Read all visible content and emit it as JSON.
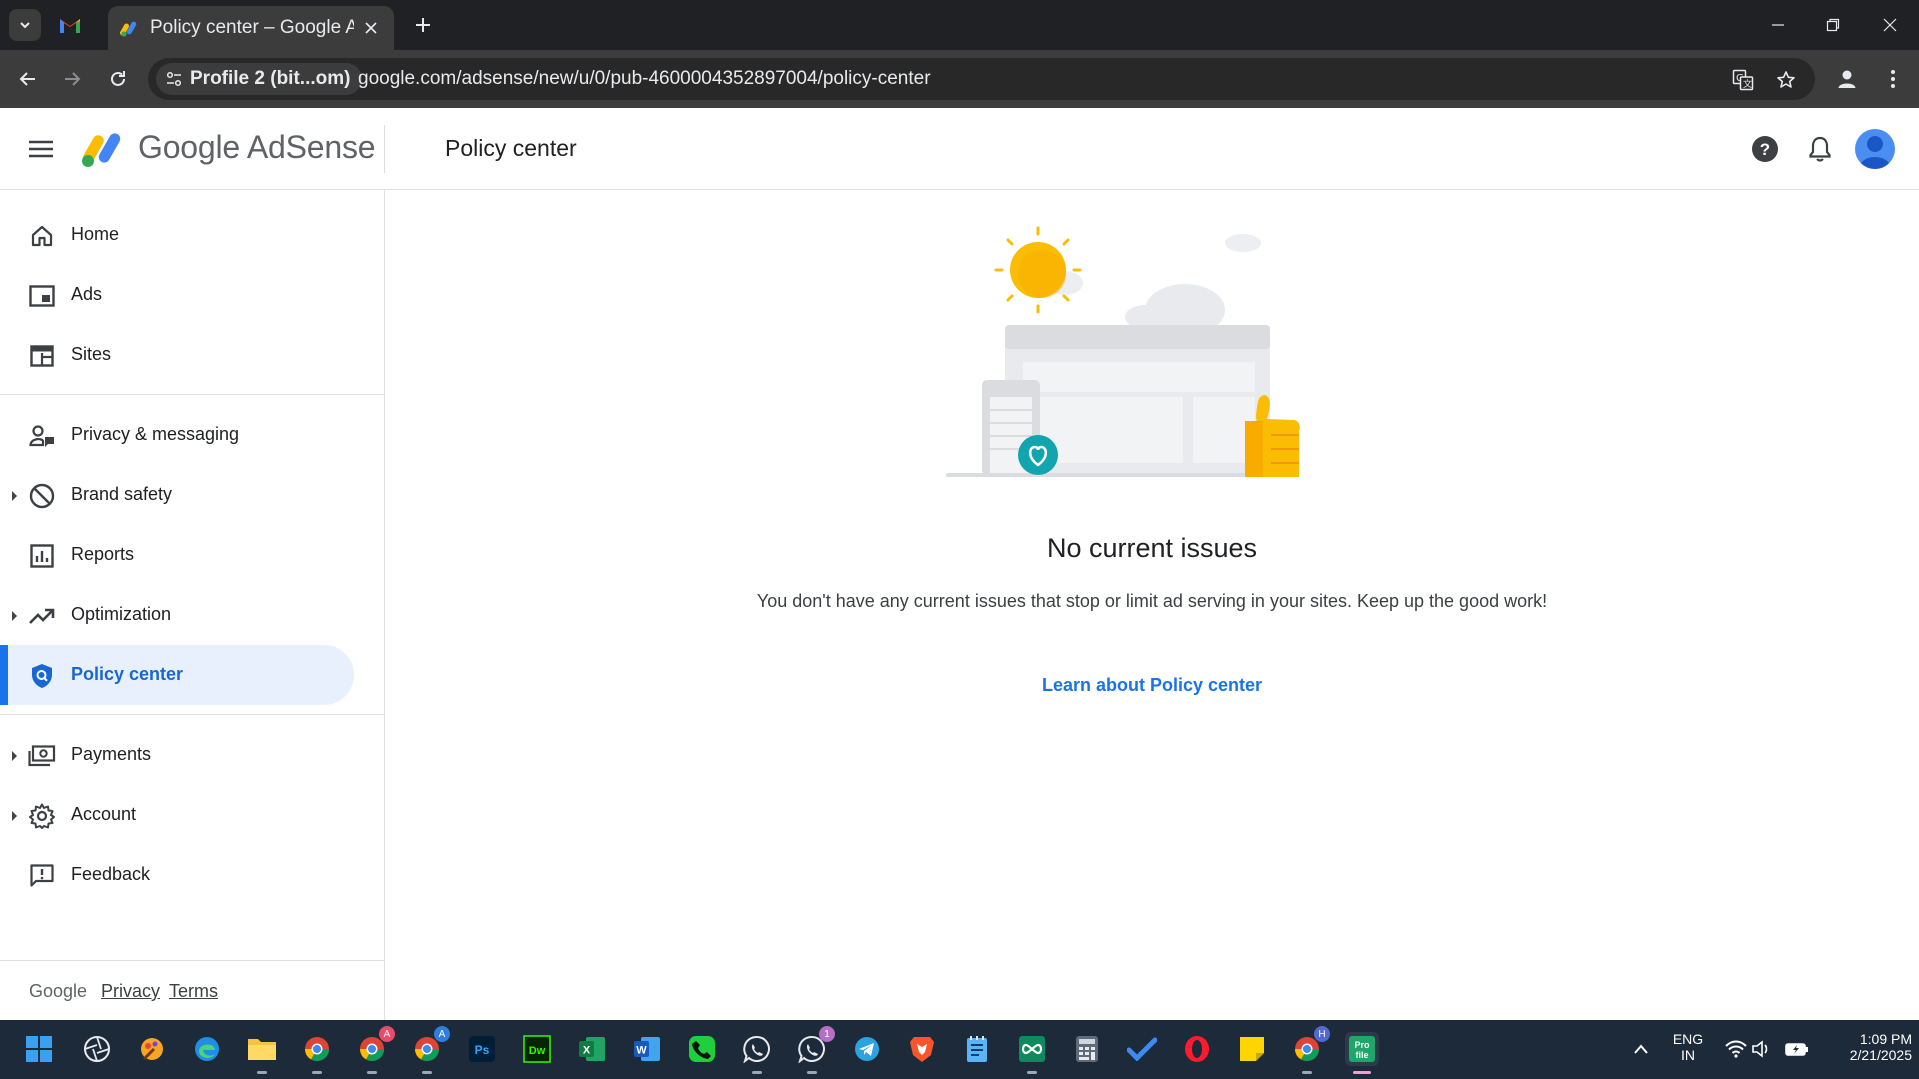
{
  "browser": {
    "tab_title": "Policy center – Google AdSense",
    "profile_chip": "Profile 2 (bit...om)",
    "url": "google.com/adsense/new/u/0/pub-4600004352897004/policy-center"
  },
  "header": {
    "logo_text": "Google AdSense",
    "page_title": "Policy center"
  },
  "sidebar": {
    "items": [
      {
        "label": "Home"
      },
      {
        "label": "Ads"
      },
      {
        "label": "Sites"
      },
      {
        "label": "Privacy & messaging"
      },
      {
        "label": "Brand safety"
      },
      {
        "label": "Reports"
      },
      {
        "label": "Optimization"
      },
      {
        "label": "Policy center"
      },
      {
        "label": "Payments"
      },
      {
        "label": "Account"
      },
      {
        "label": "Feedback"
      }
    ],
    "footer": {
      "brand": "Google",
      "privacy": "Privacy",
      "terms": "Terms"
    }
  },
  "main": {
    "headline": "No current issues",
    "message": "You don't have any current issues that stop or limit ad serving in your sites. Keep up the good work!",
    "learn_link": "Learn about Policy center"
  },
  "taskbar": {
    "whatsapp_badge": "1",
    "chrome_profile_a": "A",
    "chrome_profile_h": "H",
    "lang_line1": "ENG",
    "lang_line2": "IN",
    "time": "1:09 PM",
    "date": "2/21/2025"
  },
  "colors": {
    "accent": "#1a73e8",
    "active_bg": "#e8f0fe",
    "sun": "#fbbc04",
    "teal_badge": "#12a4af"
  }
}
